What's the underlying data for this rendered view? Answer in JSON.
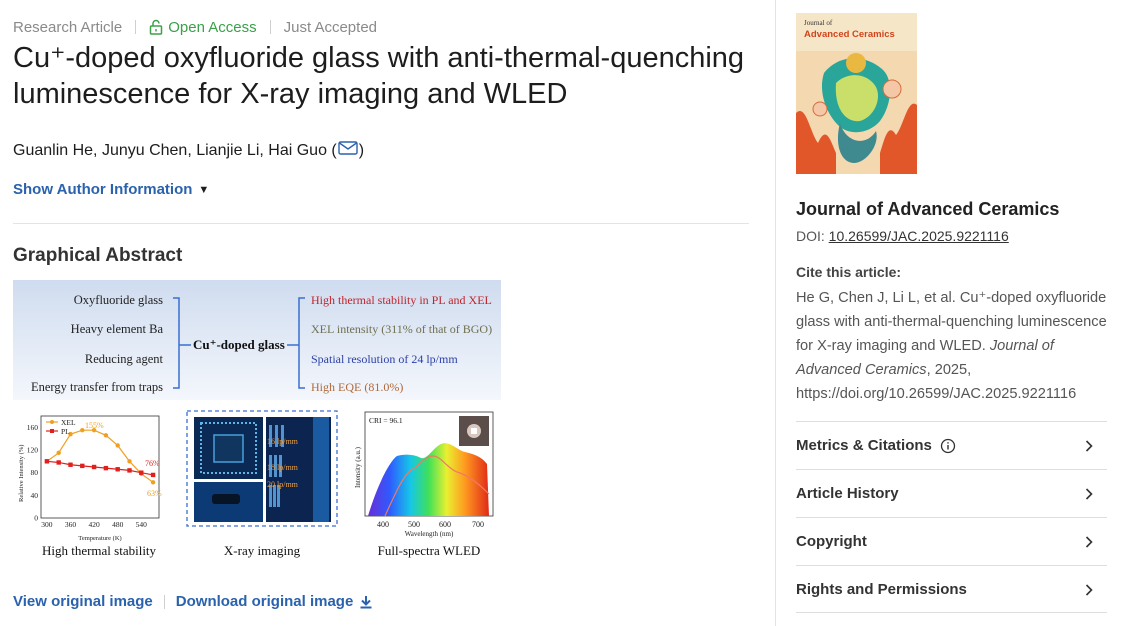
{
  "article": {
    "type": "Research Article",
    "access": "Open Access",
    "status": "Just Accepted",
    "title": "Cu⁺-doped oxyfluoride glass with anti-thermal-quenching luminescence for X-ray imaging and WLED",
    "authors": "Guanlin He, Junyu Chen, Lianjie Li, Hai Guo (",
    "authors_end": ")",
    "show_author": "Show Author Information"
  },
  "graphical_abstract": {
    "heading": "Graphical Abstract",
    "left_items": [
      "Oxyfluoride glass",
      "Heavy element Ba",
      "Reducing agent",
      "Energy transfer from traps"
    ],
    "center_label": "Cu⁺-doped glass",
    "right_items": [
      {
        "text": "High thermal stability in PL and XEL",
        "color": "#c0242c"
      },
      {
        "text": "XEL intensity (311% of that of BGO)",
        "color": "#6f6f4f"
      },
      {
        "text": "Spatial resolution of 24 lp/mm",
        "color": "#2b3fa8"
      },
      {
        "text": "High EQE (81.0%)",
        "color": "#b0683a"
      }
    ],
    "panel1": {
      "caption": "High thermal stability",
      "legend": [
        "XEL",
        "PL"
      ],
      "ylabel": "Relative Intensity (%)",
      "xlabel": "Temperature (K)",
      "yticks": [
        "0",
        "40",
        "80",
        "120",
        "160"
      ],
      "xticks": [
        "300",
        "360",
        "420",
        "480",
        "540"
      ],
      "xel_points": [
        100,
        115,
        148,
        155,
        155,
        146,
        128,
        100,
        78,
        63
      ],
      "pl_points": [
        100,
        98,
        94,
        92,
        90,
        88,
        86,
        84,
        80,
        76
      ],
      "x_points": [
        300,
        330,
        360,
        390,
        420,
        450,
        480,
        510,
        540,
        570
      ],
      "labels": {
        "peak": "155%",
        "pl_end": "76%",
        "xel_end": "63%"
      }
    },
    "panel2": {
      "caption": "X-ray imaging",
      "lp_labels": [
        "16 lp/mm",
        "18 lp/mm",
        "20 lp/mm"
      ]
    },
    "panel3": {
      "caption": "Full-spectra WLED",
      "cri": "CRI = 96.1",
      "ylabel": "Intensity (a.u.)",
      "xlabel": "Wavelength (nm)",
      "xticks": [
        "400",
        "500",
        "600",
        "700"
      ]
    },
    "view_link": "View original image",
    "download_link": "Download original image"
  },
  "sidebar": {
    "cover": {
      "journal_word": "Journal of",
      "journal_title": "Advanced Ceramics"
    },
    "journal_name": "Journal of Advanced Ceramics",
    "doi_label": "DOI: ",
    "doi_value": "10.26599/JAC.2025.9221116",
    "cite_label": "Cite this article:",
    "cite_pre": "He G, Chen J, Li L, et al. Cu⁺-doped oxyfluoride glass with anti-thermal-quenching luminescence for X-ray imaging and WLED. ",
    "cite_journal": "Journal of Advanced Ceramics",
    "cite_post": ", 2025, https://doi.org/10.26599/JAC.2025.9221116",
    "accordion": [
      "Metrics & Citations",
      "Article History",
      "Copyright",
      "Rights and Permissions"
    ]
  },
  "colors": {
    "link": "#2a62ad",
    "open_access": "#3aa04a",
    "xel": "#f0a020",
    "pl": "#e0201c"
  }
}
